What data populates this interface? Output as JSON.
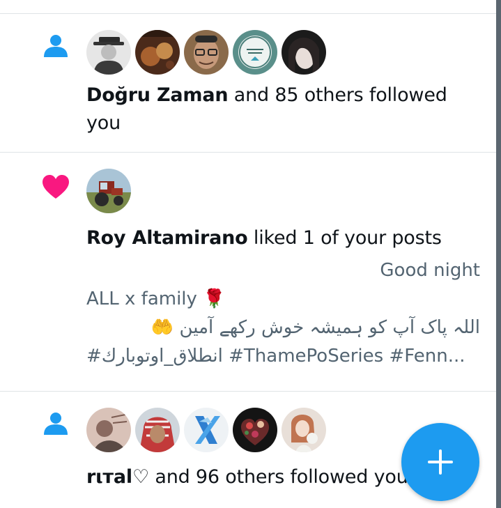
{
  "notifications": [
    {
      "type": "follow",
      "type_icon": "person-icon",
      "icon_color": "#1d9bf0",
      "avatars": [
        "hat-man-avatar",
        "artwork-avatar",
        "glasses-man-avatar",
        "quran-logo-avatar",
        "woman-avatar"
      ],
      "actor": "Doğru Zaman",
      "text_line1": " and 85 others followed",
      "text_line2": "you"
    },
    {
      "type": "like",
      "type_icon": "heart-icon",
      "icon_color": "#f91880",
      "avatars": [
        "tractor-avatar"
      ],
      "actor": "Roy Altamirano",
      "text": " liked 1 of your posts",
      "post_line1": "Good night",
      "post_line2": "ALL x family 🌹",
      "post_line3": "اللہ پاک آپ کو ہمیشہ خوش رکھے آمین 🤲",
      "post_line4": "#انطلاق_اوتوبارك #ThamePoSeries #Fenn..."
    },
    {
      "type": "follow",
      "type_icon": "person-icon",
      "icon_color": "#1d9bf0",
      "avatars": [
        "sketch-avatar",
        "keffiyeh-man-avatar",
        "x-logo-avatar",
        "floral-heart-avatar",
        "flower-woman-avatar"
      ],
      "actor": "rιтal♡",
      "text": " and 96 others followed you"
    }
  ],
  "fab": {
    "icon": "plus-icon",
    "color": "#1d9bf0"
  }
}
